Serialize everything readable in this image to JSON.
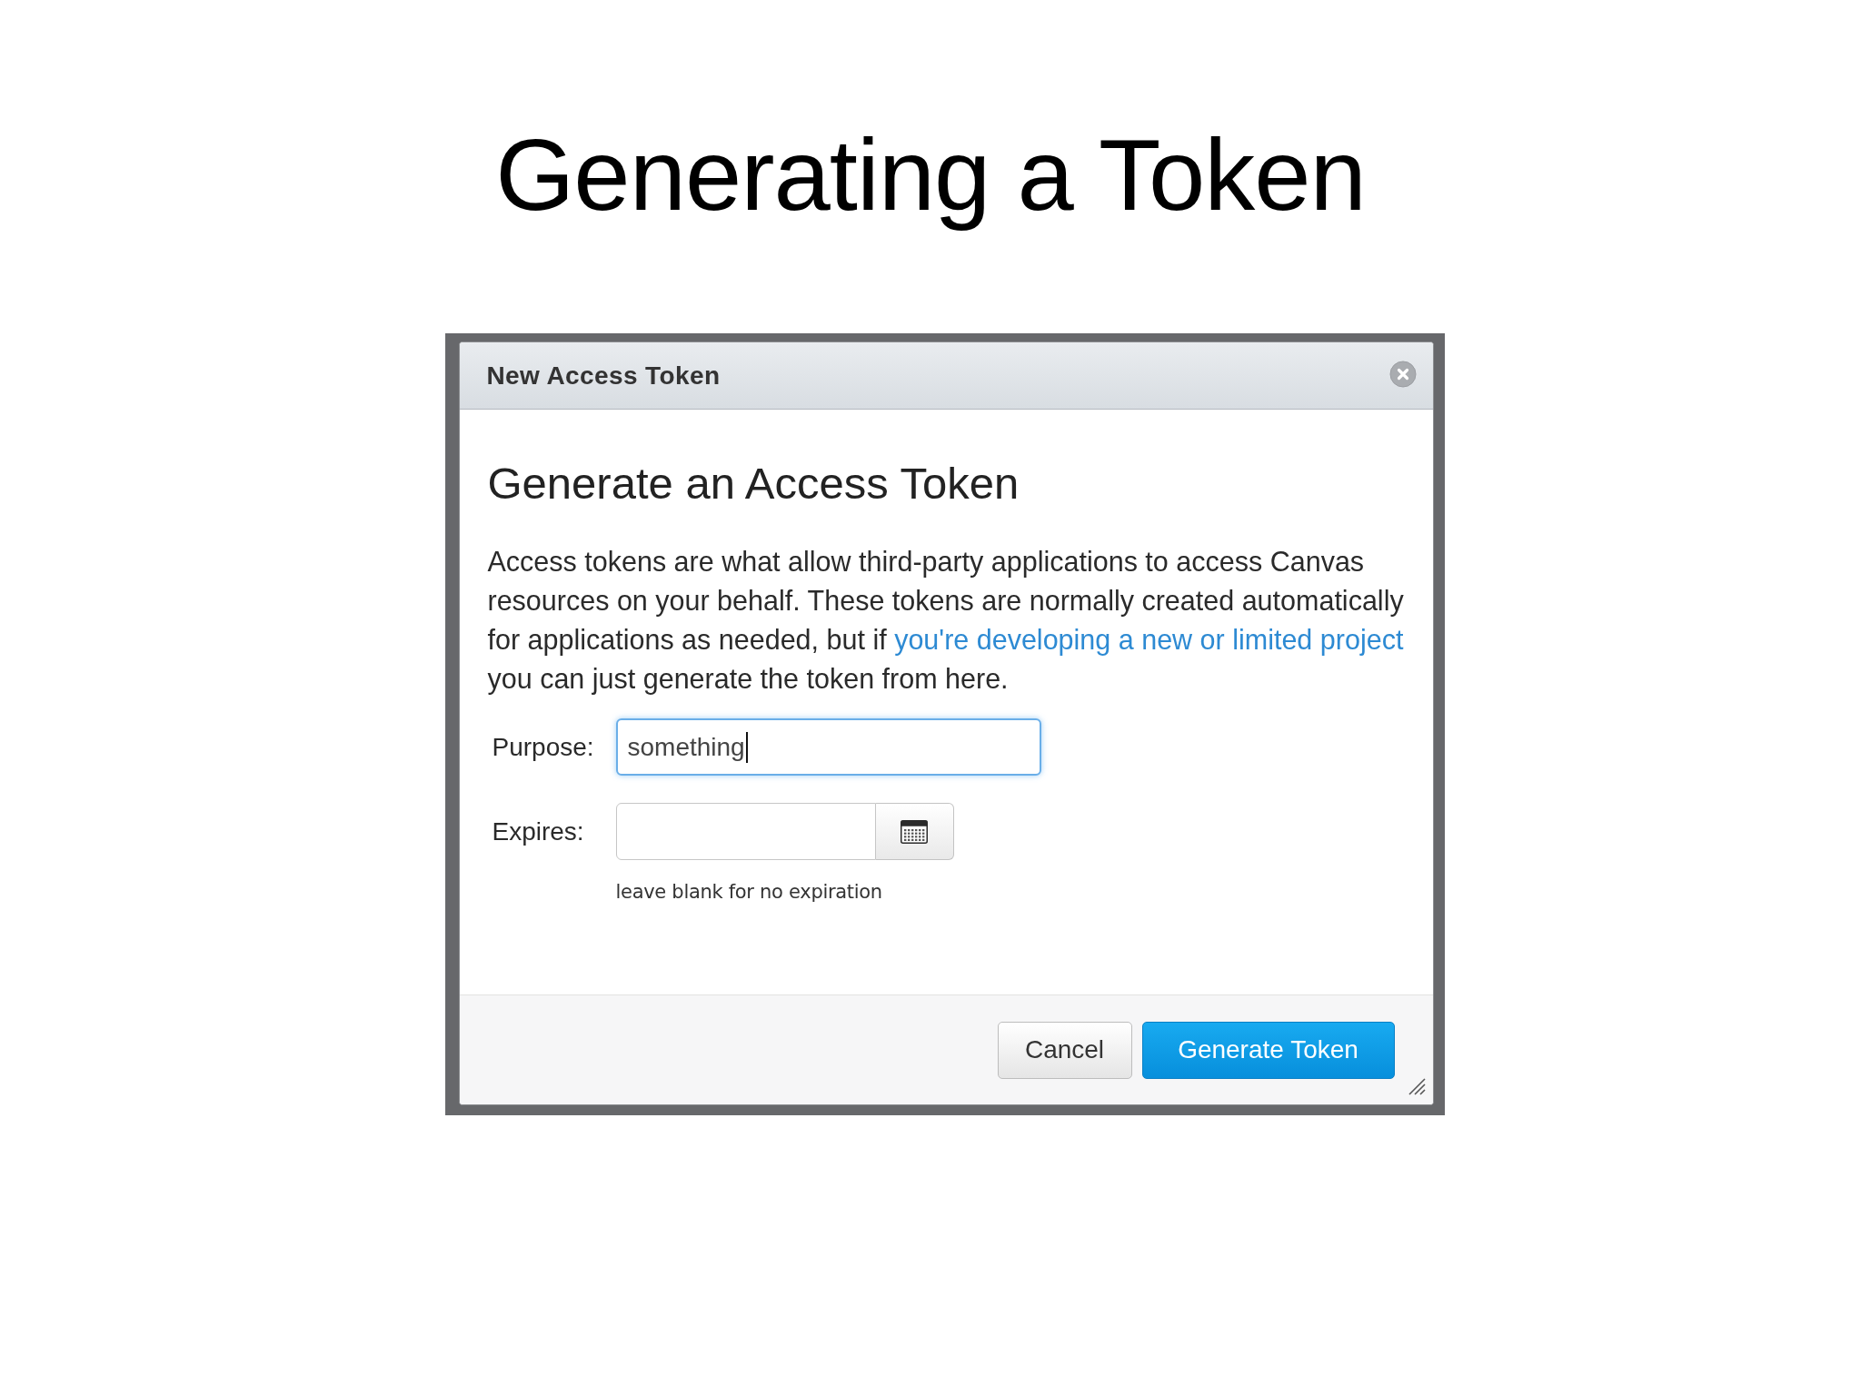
{
  "slide": {
    "title": "Generating a Token"
  },
  "dialog": {
    "title": "New Access Token",
    "heading": "Generate an Access Token",
    "description": [
      {
        "kind": "text",
        "text": "Access tokens are what allow third-party applications to access Canvas resources on your behalf. These tokens are normally created automatically for applications as needed, but if "
      },
      {
        "kind": "link",
        "text": "you're developing a new or limited project"
      },
      {
        "kind": "text",
        "text": " you can just generate the token from here."
      }
    ],
    "fields": [
      {
        "kind": "text",
        "label": "Purpose:",
        "value": "something",
        "focused": true
      },
      {
        "kind": "date",
        "label": "Expires:",
        "focused": false,
        "hint": "leave blank for no expiration"
      }
    ],
    "buttons": [
      {
        "kind": "secondary",
        "label": "Cancel"
      },
      {
        "kind": "primary",
        "label": "Generate Token"
      }
    ]
  }
}
